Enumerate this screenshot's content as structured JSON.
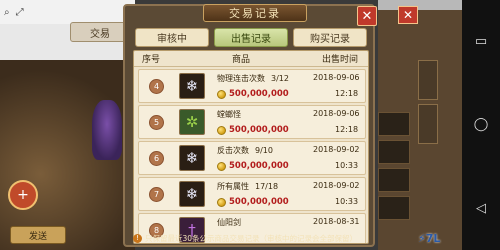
{
  "background": {
    "tab_left": "交易",
    "chat_line_1": "",
    "send_label": "发送"
  },
  "modal": {
    "title": "交易记录",
    "tabs": [
      {
        "label": "审核中",
        "active": false
      },
      {
        "label": "出售记录",
        "active": true
      },
      {
        "label": "购买记录",
        "active": false
      }
    ],
    "headers": {
      "no": "序号",
      "item": "商品",
      "time": "出售时间"
    },
    "rows": [
      {
        "no": "4",
        "icon": "snowflake-orb-icon",
        "name": "物理连击次数",
        "count": "3/12",
        "price": "500,000,000",
        "date": "2018-09-06",
        "time": "12:18"
      },
      {
        "no": "5",
        "icon": "mantis-monster-icon",
        "name": "螳螂怪",
        "count": "",
        "price": "500,000,000",
        "date": "2018-09-06",
        "time": "12:18"
      },
      {
        "no": "6",
        "icon": "snowflake-orb-icon",
        "name": "反击次数",
        "count": "9/10",
        "price": "500,000,000",
        "date": "2018-09-02",
        "time": "10:33"
      },
      {
        "no": "7",
        "icon": "snowflake-orb-icon",
        "name": "所有属性",
        "count": "17/18",
        "price": "500,000,000",
        "date": "2018-09-02",
        "time": "10:33"
      },
      {
        "no": "8",
        "icon": "sword-icon",
        "name": "仙阳剑",
        "count": "",
        "price": "",
        "date": "2018-08-31",
        "time": ""
      }
    ],
    "footer": "只保留最近30条公示商品交易记录（审核中的记录会全部保留）"
  },
  "colors": {
    "price": "#b21c1c",
    "active_tab": "#b8c77c",
    "close": "#c0392b"
  }
}
